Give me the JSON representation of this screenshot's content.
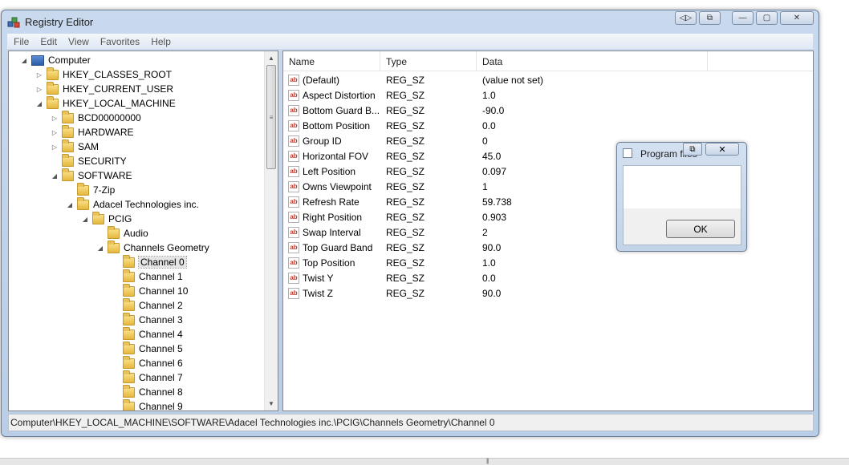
{
  "window": {
    "title": "Registry Editor",
    "caption_buttons": [
      "◁▷",
      "⧉",
      "—",
      "▢",
      "✕"
    ]
  },
  "menu": [
    "File",
    "Edit",
    "View",
    "Favorites",
    "Help"
  ],
  "tree": [
    {
      "label": "Computer",
      "level": 0,
      "expander": "◢",
      "icon": "computer"
    },
    {
      "label": "HKEY_CLASSES_ROOT",
      "level": 1,
      "expander": "▷",
      "icon": "folder"
    },
    {
      "label": "HKEY_CURRENT_USER",
      "level": 1,
      "expander": "▷",
      "icon": "folder"
    },
    {
      "label": "HKEY_LOCAL_MACHINE",
      "level": 1,
      "expander": "◢",
      "icon": "folder"
    },
    {
      "label": "BCD00000000",
      "level": 2,
      "expander": "▷",
      "icon": "folder"
    },
    {
      "label": "HARDWARE",
      "level": 2,
      "expander": "▷",
      "icon": "folder"
    },
    {
      "label": "SAM",
      "level": 2,
      "expander": "▷",
      "icon": "folder"
    },
    {
      "label": "SECURITY",
      "level": 2,
      "expander": "",
      "icon": "folder"
    },
    {
      "label": "SOFTWARE",
      "level": 2,
      "expander": "◢",
      "icon": "folder"
    },
    {
      "label": "7-Zip",
      "level": 3,
      "expander": "",
      "icon": "folder"
    },
    {
      "label": "Adacel Technologies inc.",
      "level": 3,
      "expander": "◢",
      "icon": "folder"
    },
    {
      "label": "PCIG",
      "level": 4,
      "expander": "◢",
      "icon": "folder"
    },
    {
      "label": "Audio",
      "level": 5,
      "expander": "",
      "icon": "folder"
    },
    {
      "label": "Channels Geometry",
      "level": 5,
      "expander": "◢",
      "icon": "folder"
    },
    {
      "label": "Channel 0",
      "level": 6,
      "expander": "",
      "icon": "folder",
      "selected": true
    },
    {
      "label": "Channel 1",
      "level": 6,
      "expander": "",
      "icon": "folder"
    },
    {
      "label": "Channel 10",
      "level": 6,
      "expander": "",
      "icon": "folder"
    },
    {
      "label": "Channel 2",
      "level": 6,
      "expander": "",
      "icon": "folder"
    },
    {
      "label": "Channel 3",
      "level": 6,
      "expander": "",
      "icon": "folder"
    },
    {
      "label": "Channel 4",
      "level": 6,
      "expander": "",
      "icon": "folder"
    },
    {
      "label": "Channel 5",
      "level": 6,
      "expander": "",
      "icon": "folder"
    },
    {
      "label": "Channel 6",
      "level": 6,
      "expander": "",
      "icon": "folder"
    },
    {
      "label": "Channel 7",
      "level": 6,
      "expander": "",
      "icon": "folder"
    },
    {
      "label": "Channel 8",
      "level": 6,
      "expander": "",
      "icon": "folder"
    },
    {
      "label": "Channel 9",
      "level": 6,
      "expander": "",
      "icon": "folder"
    }
  ],
  "list": {
    "columns": [
      "Name",
      "Type",
      "Data"
    ],
    "rows": [
      {
        "name": "(Default)",
        "type": "REG_SZ",
        "data": "(value not set)"
      },
      {
        "name": "Aspect Distortion",
        "type": "REG_SZ",
        "data": "1.0"
      },
      {
        "name": "Bottom Guard B...",
        "type": "REG_SZ",
        "data": "-90.0"
      },
      {
        "name": "Bottom Position",
        "type": "REG_SZ",
        "data": "0.0"
      },
      {
        "name": "Group ID",
        "type": "REG_SZ",
        "data": "0"
      },
      {
        "name": "Horizontal FOV",
        "type": "REG_SZ",
        "data": "45.0"
      },
      {
        "name": "Left Position",
        "type": "REG_SZ",
        "data": "0.097"
      },
      {
        "name": "Owns Viewpoint",
        "type": "REG_SZ",
        "data": "1"
      },
      {
        "name": "Refresh Rate",
        "type": "REG_SZ",
        "data": "59.738"
      },
      {
        "name": "Right Position",
        "type": "REG_SZ",
        "data": "0.903"
      },
      {
        "name": "Swap Interval",
        "type": "REG_SZ",
        "data": "2"
      },
      {
        "name": "Top Guard Band",
        "type": "REG_SZ",
        "data": "90.0"
      },
      {
        "name": "Top Position",
        "type": "REG_SZ",
        "data": "1.0"
      },
      {
        "name": "Twist Y",
        "type": "REG_SZ",
        "data": "0.0"
      },
      {
        "name": "Twist Z",
        "type": "REG_SZ",
        "data": "90.0"
      }
    ],
    "value_icon_text": "ab"
  },
  "statusbar": {
    "path": "Computer\\HKEY_LOCAL_MACHINE\\SOFTWARE\\Adacel Technologies inc.\\PCIG\\Channels Geometry\\Channel 0"
  },
  "popup": {
    "title": "Program files",
    "ok_label": "OK",
    "close_glyph": "✕",
    "restore_glyph": "⧉"
  },
  "scrollbar": {
    "up": "▲",
    "down": "▼",
    "grip": "≡"
  },
  "colors": {
    "window_frame": "#c9d9ee",
    "selection": "#e5e5e5"
  }
}
